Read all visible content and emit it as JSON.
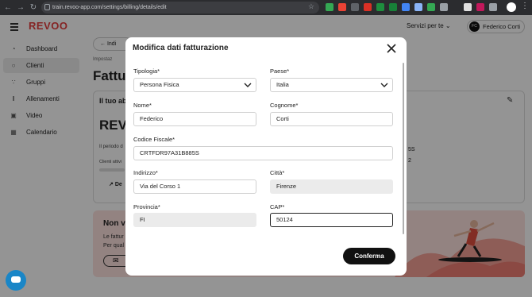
{
  "browser": {
    "url": "train.revoo-app.com/settings/billing/details/edit"
  },
  "app": {
    "logo": "REVOO",
    "services_label": "Servizi per te",
    "user_initials": "FC",
    "user_name": "Federico Corti"
  },
  "sidebar": {
    "items": [
      {
        "label": "Dashboard",
        "icon": "gauge-icon"
      },
      {
        "label": "Clienti",
        "icon": "user-icon"
      },
      {
        "label": "Gruppi",
        "icon": "group-icon"
      },
      {
        "label": "Allenamenti",
        "icon": "dumbbell-icon"
      },
      {
        "label": "Video",
        "icon": "video-icon"
      },
      {
        "label": "Calendario",
        "icon": "calendar-icon"
      }
    ]
  },
  "background": {
    "back_label": "Indi",
    "breadcrumb": "Impostaz",
    "title": "Fattu",
    "card_title": "Il tuo ab",
    "card_big": "REVO",
    "card_period": "Il periodo d",
    "card_clients": "Clienti attivi",
    "card_link": "De",
    "card_r1": "5S",
    "card_r2": "2",
    "banner_title": "Non ve",
    "banner_l1": "Le fattur",
    "banner_l2": "Per qual"
  },
  "modal": {
    "title": "Modifica dati fatturazione",
    "confirm_label": "Conferma",
    "fields": {
      "tipologia": {
        "label": "Tipologia*",
        "value": "Persona Fisica"
      },
      "paese": {
        "label": "Paese*",
        "value": "Italia"
      },
      "nome": {
        "label": "Nome*",
        "value": "Federico"
      },
      "cognome": {
        "label": "Cognome*",
        "value": "Corti"
      },
      "codice_fiscale": {
        "label": "Codice Fiscale*",
        "value": "CRTFDR97A31B885S"
      },
      "indirizzo": {
        "label": "Indirizzo*",
        "value": "Via del Corso 1"
      },
      "citta": {
        "label": "Città*",
        "value": "Firenze"
      },
      "provincia": {
        "label": "Provincia*",
        "value": "FI"
      },
      "cap": {
        "label": "CAP*",
        "value": "50124"
      }
    }
  }
}
